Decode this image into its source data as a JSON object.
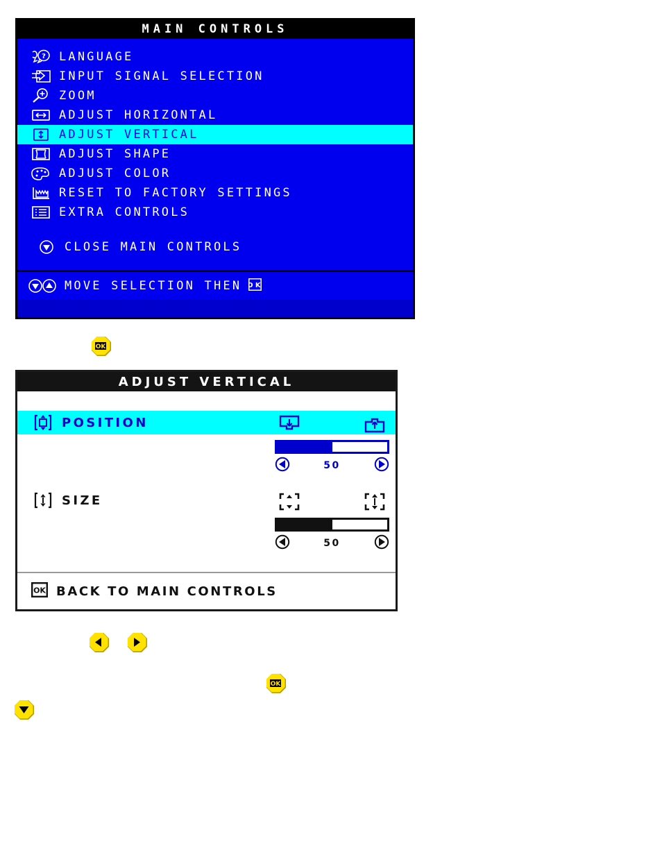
{
  "main_controls": {
    "title": "MAIN CONTROLS",
    "items": [
      {
        "icon": "language-icon",
        "label": "LANGUAGE",
        "selected": false
      },
      {
        "icon": "input-signal-icon",
        "label": "INPUT SIGNAL SELECTION",
        "selected": false
      },
      {
        "icon": "zoom-icon",
        "label": "ZOOM",
        "selected": false
      },
      {
        "icon": "adjust-horizontal-icon",
        "label": "ADJUST HORIZONTAL",
        "selected": false
      },
      {
        "icon": "adjust-vertical-icon",
        "label": "ADJUST VERTICAL",
        "selected": true
      },
      {
        "icon": "adjust-shape-icon",
        "label": "ADJUST SHAPE",
        "selected": false
      },
      {
        "icon": "adjust-color-icon",
        "label": "ADJUST COLOR",
        "selected": false
      },
      {
        "icon": "reset-factory-icon",
        "label": "RESET TO FACTORY SETTINGS",
        "selected": false
      },
      {
        "icon": "extra-controls-icon",
        "label": "EXTRA CONTROLS",
        "selected": false
      }
    ],
    "close_item": {
      "icon": "down-arrow-icon",
      "label": "CLOSE MAIN CONTROLS"
    },
    "footer": {
      "icons": [
        "down-arrow-icon",
        "up-arrow-icon"
      ],
      "label": "MOVE SELECTION THEN",
      "trailing_icon": "ok-icon"
    },
    "colors": {
      "background": "#0000ee",
      "titlebar": "#000000",
      "text": "#ffffff",
      "highlight": "#00ffff",
      "highlight_text": "#0000ee"
    }
  },
  "step_ok_button_1": {
    "icon": "ok-button-icon",
    "label": "OK"
  },
  "adjust_vertical": {
    "title": "ADJUST VERTICAL",
    "rows": [
      {
        "icon": "vertical-position-icon",
        "label": "POSITION",
        "selected": true,
        "left_action_icon": "move-down-icon",
        "right_action_icon": "move-up-icon",
        "slider": {
          "value": "50",
          "percent": 50,
          "left_icon": "left-arrow-icon",
          "right_icon": "right-arrow-icon",
          "color": "#0000cc"
        }
      },
      {
        "icon": "vertical-size-icon",
        "label": "SIZE",
        "selected": false,
        "left_action_icon": "shrink-vertical-icon",
        "right_action_icon": "expand-vertical-icon",
        "slider": {
          "value": "50",
          "percent": 50,
          "left_icon": "left-arrow-icon",
          "right_icon": "right-arrow-icon",
          "color": "#111111"
        }
      }
    ],
    "footer": {
      "icon": "ok-icon",
      "label": "BACK TO MAIN CONTROLS"
    },
    "colors": {
      "background": "#ffffff",
      "titlebar": "#141414",
      "text": "#111111",
      "highlight": "#00ffff",
      "accent": "#0000cc"
    }
  },
  "step_buttons": {
    "left": {
      "icon": "left-arrow-button-icon",
      "label": "LEFT"
    },
    "right": {
      "icon": "right-arrow-button-icon",
      "label": "RIGHT"
    }
  },
  "step_ok_button_2": {
    "icon": "ok-button-icon",
    "label": "OK"
  },
  "step_down_button": {
    "icon": "down-arrow-button-icon",
    "label": "DOWN"
  },
  "button_colors": {
    "face": "#ffe200",
    "shadow": "#b39a00",
    "glyph": "#000000"
  }
}
